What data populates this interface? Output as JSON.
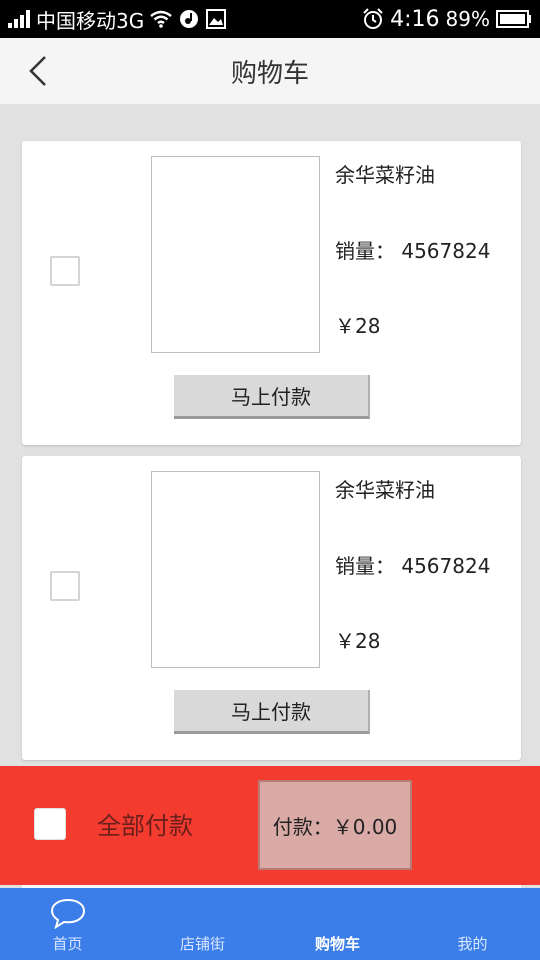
{
  "status_bar": {
    "carrier": "中国移动3G",
    "time": "4:16",
    "battery": "89%"
  },
  "header": {
    "title": "购物车"
  },
  "cart_items": [
    {
      "name": "余华菜籽油",
      "sales": "销量：  4567824",
      "price": "￥28",
      "pay_label": "马上付款",
      "checked": false
    },
    {
      "name": "余华菜籽油",
      "sales": "销量：  4567824",
      "price": "￥28",
      "pay_label": "马上付款",
      "checked": false
    }
  ],
  "checkout": {
    "all_pay_label": "全部付款",
    "total_label": "付款：￥0.00"
  },
  "bottom_nav": {
    "items": [
      {
        "label": "首页",
        "icon": "chat-bubble-icon"
      },
      {
        "label": "店铺街",
        "icon": ""
      },
      {
        "label": "购物车",
        "icon": "",
        "active": true
      },
      {
        "label": "我的",
        "icon": ""
      }
    ]
  },
  "colors": {
    "nav_bg": "#3c7ee9",
    "checkout_bg": "#f33b30",
    "page_bg": "#e1e1e1"
  }
}
